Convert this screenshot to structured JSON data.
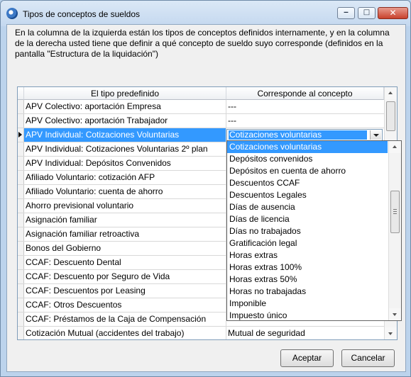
{
  "window": {
    "title": "Tipos de conceptos de sueldos"
  },
  "description": "En la columna de la izquierda están los tipos de conceptos definidos internamente, y en la columna de la derecha usted tiene que definir a qué concepto de sueldo suyo corresponde (definidos en la pantalla \"Estructura de la liquidación\")",
  "grid": {
    "headers": {
      "left": "El tipo predefinido",
      "right": "Corresponde al concepto"
    },
    "rows": [
      {
        "type": "APV Colectivo: aportación Empresa",
        "concept": "---"
      },
      {
        "type": "APV Colectivo: aportación Trabajador",
        "concept": "---"
      },
      {
        "type": "APV Individual: Cotizaciones Voluntarias",
        "concept": "Cotizaciones voluntarias"
      },
      {
        "type": "APV Individual: Cotizaciones Voluntarias 2º plan",
        "concept": ""
      },
      {
        "type": "APV Individual: Depósitos Convenidos",
        "concept": ""
      },
      {
        "type": "Afiliado Voluntario: cotización AFP",
        "concept": ""
      },
      {
        "type": "Afiliado Voluntario: cuenta de ahorro",
        "concept": ""
      },
      {
        "type": "Ahorro previsional voluntario",
        "concept": ""
      },
      {
        "type": "Asignación familiar",
        "concept": ""
      },
      {
        "type": "Asignación familiar retroactiva",
        "concept": ""
      },
      {
        "type": "Bonos del Gobierno",
        "concept": ""
      },
      {
        "type": "CCAF: Descuento Dental",
        "concept": ""
      },
      {
        "type": "CCAF: Descuento por Seguro de Vida",
        "concept": ""
      },
      {
        "type": "CCAF: Descuentos por Leasing",
        "concept": ""
      },
      {
        "type": "CCAF: Otros Descuentos",
        "concept": ""
      },
      {
        "type": "CCAF: Préstamos de la Caja de Compensación",
        "concept": ""
      },
      {
        "type": "Cotización Mutual (accidentes del trabajo)",
        "concept": "Mutual de seguridad"
      }
    ]
  },
  "dropdown_options": [
    "Cotizaciones voluntarias",
    "Depósitos convenidos",
    "Depósitos en cuenta de ahorro",
    "Descuentos CCAF",
    "Descuentos Legales",
    "Días de ausencia",
    "Días de licencia",
    "Días no trabajados",
    "Gratificación legal",
    "Horas extras",
    "Horas extras 100%",
    "Horas extras 50%",
    "Horas no trabajadas",
    "Imponible",
    "Impuesto único"
  ],
  "buttons": {
    "accept": "Aceptar",
    "cancel": "Cancelar"
  }
}
